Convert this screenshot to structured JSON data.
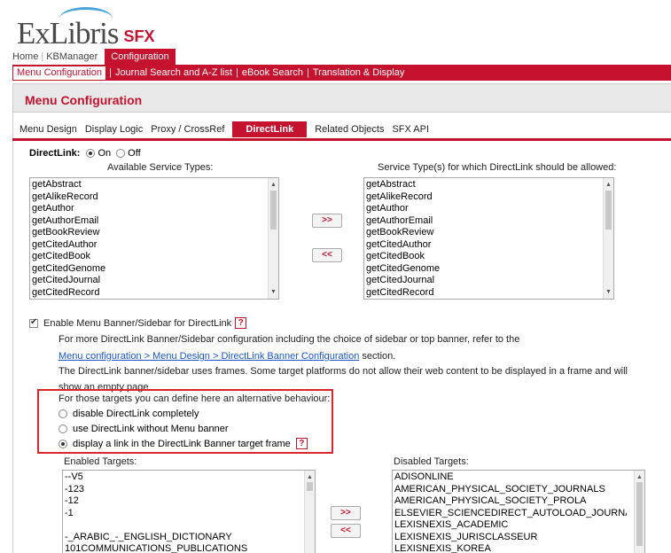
{
  "header": {
    "logo_text": "ExLibris",
    "logo_product": "SFX",
    "top_nav": [
      "Home",
      "KBManager",
      "Configuration"
    ],
    "active_top": "Configuration"
  },
  "subnav": {
    "items": [
      "Menu Configuration",
      "Journal Search and A-Z list",
      "eBook Search",
      "Translation & Display"
    ],
    "active": "Menu Configuration"
  },
  "page_title": "Menu Configuration",
  "tabs": [
    "Menu Design",
    "Display Logic",
    "Proxy / CrossRef",
    "DirectLink",
    "Related Objects",
    "SFX API"
  ],
  "active_tab": "DirectLink",
  "directlink": {
    "label": "DirectLink:",
    "on_label": "On",
    "off_label": "Off",
    "selected": "On"
  },
  "available_services": {
    "header": "Available Service Types:",
    "items": [
      "getAbstract",
      "getAlikeRecord",
      "getAuthor",
      "getAuthorEmail",
      "getBookReview",
      "getCitedAuthor",
      "getCitedBook",
      "getCitedGenome",
      "getCitedJournal",
      "getCitedRecord"
    ]
  },
  "allowed_services": {
    "header": "Service Type(s) for which DirectLink should be allowed:",
    "items": [
      "getAbstract",
      "getAlikeRecord",
      "getAuthor",
      "getAuthorEmail",
      "getBookReview",
      "getCitedAuthor",
      "getCitedBook",
      "getCitedGenome",
      "getCitedJournal",
      "getCitedRecord"
    ]
  },
  "move_buttons": {
    "add": ">>",
    "remove": "<<"
  },
  "banner": {
    "checkbox_label": "Enable Menu Banner/Sidebar for DirectLink",
    "checked": true,
    "help": "?",
    "info_line1": "For more DirectLink Banner/Sidebar configuration including the choice of sidebar or top banner, refer to the",
    "info_link": "Menu configuration > Menu Design > DirectLink Banner Configuration",
    "info_link_suffix": " section.",
    "info_line3": "The DirectLink banner/sidebar uses frames. Some target platforms do not allow their web content to be displayed in a frame and will",
    "info_line4": "show an empty page."
  },
  "alternative": {
    "intro": "For those targets you can define here an alternative behaviour:",
    "options": [
      {
        "label": "disable DirectLink completely",
        "selected": false
      },
      {
        "label": "use DirectLink without Menu banner",
        "selected": false
      },
      {
        "label": "display a link in the DirectLink Banner target frame",
        "selected": true
      }
    ],
    "help": "?"
  },
  "enabled_targets": {
    "header": "Enabled Targets:",
    "items": [
      "--V5",
      "-123",
      "-12",
      "-1",
      "",
      "-_ARABIC_-_ENGLISH_DICTIONARY",
      "101COMMUNICATIONS_PUBLICATIONS"
    ]
  },
  "disabled_targets": {
    "header": "Disabled Targets:",
    "items": [
      "ADISONLINE",
      "AMERICAN_PHYSICAL_SOCIETY_JOURNALS",
      "AMERICAN_PHYSICAL_SOCIETY_PROLA",
      "ELSEVIER_SCIENCEDIRECT_AUTOLOAD_JOURNALS",
      "LEXISNEXIS_ACADEMIC",
      "LEXISNEXIS_JURISCLASSEUR",
      "LEXISNEXIS_KOREA"
    ]
  },
  "colors": {
    "brand": "#c4122f",
    "highlight_box": "#d9262b",
    "link": "#1a56c9"
  }
}
